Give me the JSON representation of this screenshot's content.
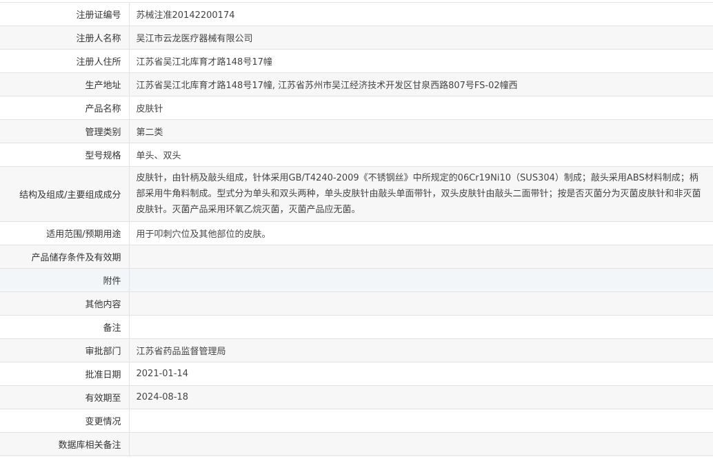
{
  "rows": [
    {
      "label": "注册证编号",
      "value": "苏械注准20142200174"
    },
    {
      "label": "注册人名称",
      "value": "吴江市云龙医疗器械有限公司"
    },
    {
      "label": "注册人住所",
      "value": "江苏省吴江北库育才路148号17幢"
    },
    {
      "label": "生产地址",
      "value": "江苏省吴江北库育才路148号17幢, 江苏省苏州市吴江经济技术开发区甘泉西路807号FS-02幢西"
    },
    {
      "label": "产品名称",
      "value": "皮肤针"
    },
    {
      "label": "管理类别",
      "value": "第二类"
    },
    {
      "label": "型号规格",
      "value": "单头、双头"
    },
    {
      "label": "结构及组成/主要组成成分",
      "value": "皮肤针，由针柄及敲头组成，针体采用GB/T4240-2009《不锈钢丝》中所规定的06Cr19Ni10（SUS304）制成；敲头采用ABS材料制成；柄部采用牛角料制成。型式分为单头和双头两种，单头皮肤针由敲头单面带针，双头皮肤针由敲头二面带针；按是否灭菌分为灭菌皮肤针和非灭菌皮肤针。灭菌产品采用环氧乙烷灭菌，灭菌产品应无菌。"
    },
    {
      "label": "适用范围/预期用途",
      "value": "用于叩刺穴位及其他部位的皮肤。"
    },
    {
      "label": "产品储存条件及有效期",
      "value": ""
    },
    {
      "label": "附件",
      "value": ""
    },
    {
      "label": "其他内容",
      "value": ""
    },
    {
      "label": "备注",
      "value": ""
    },
    {
      "label": "审批部门",
      "value": "江苏省药品监督管理局"
    },
    {
      "label": "批准日期",
      "value": "2021-01-14"
    },
    {
      "label": "有效期至",
      "value": "2024-08-18"
    },
    {
      "label": "变更情况",
      "value": ""
    },
    {
      "label": "数据库相关备注",
      "value": ""
    }
  ]
}
